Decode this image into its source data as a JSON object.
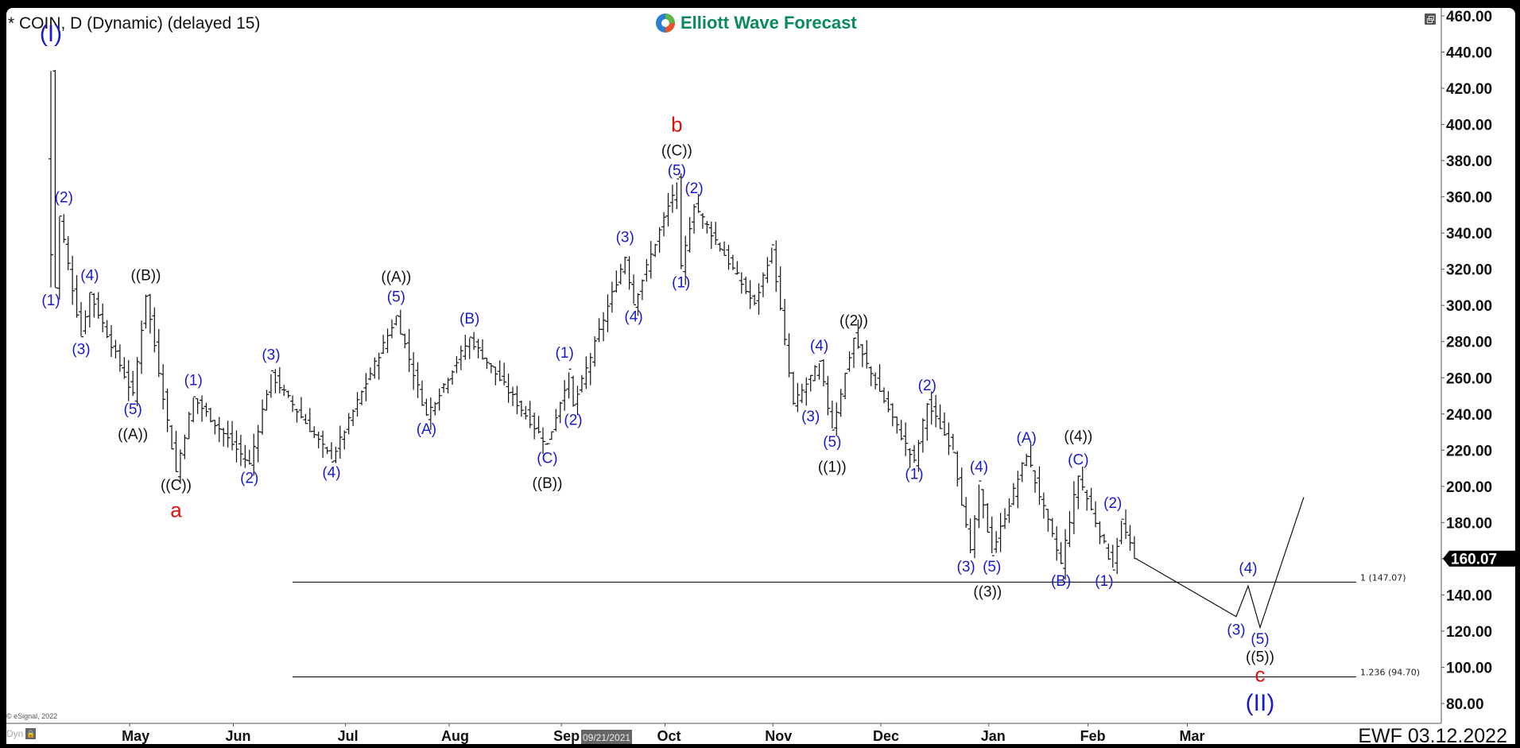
{
  "window": {
    "title": "* COIN, D (Dynamic) (delayed 15)",
    "brand": "Elliott Wave Forecast",
    "restore_button": "restore-window",
    "copyright": "© eSignal, 2022",
    "dyn_label": "Dyn",
    "footer_stamp": "EWF 03.12.2022",
    "date_cursor": "09/21/2021"
  },
  "chart_data": {
    "type": "ohlc",
    "symbol": "COIN",
    "interval": "D",
    "title": "* COIN, D (Dynamic) (delayed 15)",
    "ylim": [
      74,
      464
    ],
    "yticks": [
      460,
      440,
      420,
      400,
      380,
      360,
      340,
      320,
      300,
      280,
      260,
      240,
      220,
      200,
      180,
      160,
      140,
      120,
      100,
      80
    ],
    "ytick_labels": [
      "460.00",
      "440.00",
      "420.00",
      "400.00",
      "380.00",
      "360.00",
      "340.00",
      "320.00",
      "300.00",
      "280.00",
      "260.00",
      "240.00",
      "220.00",
      "200.00",
      "180.00",
      "160.00",
      "140.00",
      "120.00",
      "100.00",
      "80.00"
    ],
    "xticks": [
      {
        "label": "May",
        "date": "2021-05-01"
      },
      {
        "label": "Jun",
        "date": "2021-06-01"
      },
      {
        "label": "Jul",
        "date": "2021-07-01"
      },
      {
        "label": "Aug",
        "date": "2021-08-01"
      },
      {
        "label": "Sep",
        "date": "2021-09-01"
      },
      {
        "label": "Oct",
        "date": "2021-10-01"
      },
      {
        "label": "Nov",
        "date": "2021-11-01"
      },
      {
        "label": "Dec",
        "date": "2021-12-01"
      },
      {
        "label": "Jan",
        "date": "2022-01-01"
      },
      {
        "label": "Feb",
        "date": "2022-02-01"
      },
      {
        "label": "Mar",
        "date": "2022-03-01"
      }
    ],
    "last_price": {
      "value": 160.07,
      "label": "160.07"
    },
    "price_path_turning_points": [
      {
        "day": 0,
        "price": 429.5
      },
      {
        "day": 1,
        "price": 310
      },
      {
        "day": 2,
        "price": 349
      },
      {
        "day": 7,
        "price": 283
      },
      {
        "day": 9,
        "price": 307
      },
      {
        "day": 19,
        "price": 250
      },
      {
        "day": 22,
        "price": 306
      },
      {
        "day": 29,
        "price": 208
      },
      {
        "day": 33,
        "price": 249
      },
      {
        "day": 46,
        "price": 212
      },
      {
        "day": 51,
        "price": 262
      },
      {
        "day": 65,
        "price": 215
      },
      {
        "day": 80,
        "price": 294
      },
      {
        "day": 87,
        "price": 239
      },
      {
        "day": 97,
        "price": 282
      },
      {
        "day": 115,
        "price": 223
      },
      {
        "day": 120,
        "price": 263
      },
      {
        "day": 121,
        "price": 244
      },
      {
        "day": 133,
        "price": 327
      },
      {
        "day": 135,
        "price": 301
      },
      {
        "day": 145,
        "price": 368
      },
      {
        "day": 146,
        "price": 320
      },
      {
        "day": 149,
        "price": 356
      },
      {
        "day": 163,
        "price": 300
      },
      {
        "day": 167,
        "price": 332
      },
      {
        "day": 172,
        "price": 245
      },
      {
        "day": 178,
        "price": 268
      },
      {
        "day": 181,
        "price": 232
      },
      {
        "day": 186,
        "price": 282
      },
      {
        "day": 200,
        "price": 213
      },
      {
        "day": 203,
        "price": 246
      },
      {
        "day": 209,
        "price": 220
      },
      {
        "day": 213,
        "price": 163
      },
      {
        "day": 215,
        "price": 201
      },
      {
        "day": 218,
        "price": 163
      },
      {
        "day": 226,
        "price": 218
      },
      {
        "day": 234,
        "price": 157
      },
      {
        "day": 238,
        "price": 206
      },
      {
        "day": 246,
        "price": 155
      },
      {
        "day": 248,
        "price": 181
      },
      {
        "day": 251,
        "price": 160.07
      }
    ],
    "projection_path": [
      {
        "price": 160.07,
        "label": "start"
      },
      {
        "price": 128,
        "label": "(3)"
      },
      {
        "price": 145,
        "label": "(4)"
      },
      {
        "price": 122,
        "label": "(5)"
      },
      {
        "price": 194,
        "label": "target"
      }
    ],
    "fib_levels": [
      {
        "ratio": "1",
        "price": 147.07,
        "label": "1 (147.07)"
      },
      {
        "ratio": "1.236",
        "price": 94.7,
        "label": "1.236 (94.70)"
      }
    ],
    "wave_labels": [
      {
        "text": "(I)",
        "color": "#1a1acc",
        "size": "xl",
        "day": 0,
        "price": 446
      },
      {
        "text": "(2)",
        "color": "#1a1acc",
        "size": "m",
        "day": 3,
        "price": 357
      },
      {
        "text": "(1)",
        "color": "#1a1acc",
        "size": "m",
        "day": 0,
        "price": 300
      },
      {
        "text": "(4)",
        "color": "#1a1acc",
        "size": "m",
        "day": 9,
        "price": 314
      },
      {
        "text": "(3)",
        "color": "#1a1acc",
        "size": "m",
        "day": 7,
        "price": 273
      },
      {
        "text": "((B))",
        "color": "#111111",
        "size": "m",
        "day": 22,
        "price": 314
      },
      {
        "text": "(5)",
        "color": "#1a1acc",
        "size": "m",
        "day": 19,
        "price": 240
      },
      {
        "text": "((A))",
        "color": "#111111",
        "size": "m",
        "day": 19,
        "price": 226
      },
      {
        "text": "((C))",
        "color": "#111111",
        "size": "m",
        "day": 29,
        "price": 198
      },
      {
        "text": "a",
        "color": "#e01010",
        "size": "l",
        "day": 29,
        "price": 183
      },
      {
        "text": "(1)",
        "color": "#1a1acc",
        "size": "m",
        "day": 33,
        "price": 256
      },
      {
        "text": "(2)",
        "color": "#1a1acc",
        "size": "m",
        "day": 46,
        "price": 202
      },
      {
        "text": "(3)",
        "color": "#1a1acc",
        "size": "m",
        "day": 51,
        "price": 270
      },
      {
        "text": "(4)",
        "color": "#1a1acc",
        "size": "m",
        "day": 65,
        "price": 205
      },
      {
        "text": "((A))",
        "color": "#111111",
        "size": "m",
        "day": 80,
        "price": 313
      },
      {
        "text": "(5)",
        "color": "#1a1acc",
        "size": "m",
        "day": 80,
        "price": 302
      },
      {
        "text": "(A)",
        "color": "#1a1acc",
        "size": "m",
        "day": 87,
        "price": 229
      },
      {
        "text": "(B)",
        "color": "#1a1acc",
        "size": "m",
        "day": 97,
        "price": 290
      },
      {
        "text": "(C)",
        "color": "#1a1acc",
        "size": "m",
        "day": 115,
        "price": 213
      },
      {
        "text": "((B))",
        "color": "#111111",
        "size": "m",
        "day": 115,
        "price": 199
      },
      {
        "text": "(1)",
        "color": "#1a1acc",
        "size": "m",
        "day": 119,
        "price": 271
      },
      {
        "text": "(2)",
        "color": "#1a1acc",
        "size": "m",
        "day": 121,
        "price": 234
      },
      {
        "text": "(3)",
        "color": "#1a1acc",
        "size": "m",
        "day": 133,
        "price": 335
      },
      {
        "text": "(4)",
        "color": "#1a1acc",
        "size": "m",
        "day": 135,
        "price": 291
      },
      {
        "text": "b",
        "color": "#e01010",
        "size": "l",
        "day": 145,
        "price": 396
      },
      {
        "text": "((C))",
        "color": "#111111",
        "size": "m",
        "day": 145,
        "price": 383
      },
      {
        "text": "(5)",
        "color": "#1a1acc",
        "size": "m",
        "day": 145,
        "price": 372
      },
      {
        "text": "(1)",
        "color": "#1a1acc",
        "size": "m",
        "day": 146,
        "price": 310
      },
      {
        "text": "(2)",
        "color": "#1a1acc",
        "size": "m",
        "day": 149,
        "price": 362
      },
      {
        "text": "(4)",
        "color": "#1a1acc",
        "size": "m",
        "day": 178,
        "price": 275
      },
      {
        "text": "(3)",
        "color": "#1a1acc",
        "size": "m",
        "day": 176,
        "price": 236
      },
      {
        "text": "(5)",
        "color": "#1a1acc",
        "size": "m",
        "day": 181,
        "price": 222
      },
      {
        "text": "((1))",
        "color": "#111111",
        "size": "m",
        "day": 181,
        "price": 208
      },
      {
        "text": "((2))",
        "color": "#111111",
        "size": "m",
        "day": 186,
        "price": 289
      },
      {
        "text": "(1)",
        "color": "#1a1acc",
        "size": "m",
        "day": 200,
        "price": 204
      },
      {
        "text": "(2)",
        "color": "#1a1acc",
        "size": "m",
        "day": 203,
        "price": 253
      },
      {
        "text": "(4)",
        "color": "#1a1acc",
        "size": "m",
        "day": 215,
        "price": 208
      },
      {
        "text": "(3)",
        "color": "#1a1acc",
        "size": "m",
        "day": 212,
        "price": 153
      },
      {
        "text": "(5)",
        "color": "#1a1acc",
        "size": "m",
        "day": 218,
        "price": 153
      },
      {
        "text": "((3))",
        "color": "#111111",
        "size": "m",
        "day": 217,
        "price": 139
      },
      {
        "text": "(A)",
        "color": "#1a1acc",
        "size": "m",
        "day": 226,
        "price": 224
      },
      {
        "text": "((4))",
        "color": "#111111",
        "size": "m",
        "day": 238,
        "price": 225
      },
      {
        "text": "(C)",
        "color": "#1a1acc",
        "size": "m",
        "day": 238,
        "price": 212
      },
      {
        "text": "(B)",
        "color": "#1a1acc",
        "size": "m",
        "day": 234,
        "price": 145
      },
      {
        "text": "(2)",
        "color": "#1a1acc",
        "size": "m",
        "day": 246,
        "price": 188
      },
      {
        "text": "(1)",
        "color": "#1a1acc",
        "size": "m",
        "day": 244,
        "price": 145
      },
      {
        "text": "(4)",
        "color": "#1a1acc",
        "size": "m",
        "x_proj": 2,
        "price": 152
      },
      {
        "text": "(3)",
        "color": "#1a1acc",
        "size": "m",
        "x_proj": 1,
        "price": 118
      },
      {
        "text": "(5)",
        "color": "#1a1acc",
        "size": "m",
        "x_proj": 3,
        "price": 113
      },
      {
        "text": "((5))",
        "color": "#111111",
        "size": "m",
        "x_proj": 3,
        "price": 103
      },
      {
        "text": "c",
        "color": "#e01010",
        "size": "l",
        "x_proj": 3,
        "price": 92
      },
      {
        "text": "(II)",
        "color": "#1a1acc",
        "size": "xl",
        "x_proj": 3,
        "price": 76
      }
    ]
  }
}
